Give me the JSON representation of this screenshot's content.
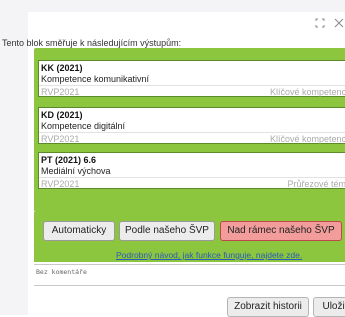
{
  "heading": "Tento blok směřuje k následujícím výstupům:",
  "toolbar": {
    "maximize_icon": "maximize-icon",
    "close_icon": "close-icon"
  },
  "outputs": [
    {
      "code": "KK (2021)",
      "name": "Kompetence komunikativní",
      "source": "RVP2021",
      "category": "Klíčové kompetence"
    },
    {
      "code": "KD (2021)",
      "name": "Kompetence digitální",
      "source": "RVP2021",
      "category": "Klíčové kompetence"
    },
    {
      "code": "PT (2021) 6.6",
      "name": "Mediální výchova",
      "source": "RVP2021",
      "category": "Průřezové téma"
    }
  ],
  "modes": {
    "automatic": "Automaticky",
    "by_svp": "Podle našeho ŠVP",
    "beyond_svp": "Nad rámec našeho ŠVP"
  },
  "help_link": "Podrobný návod, jak funkce funguje, najdete zde.",
  "comment_placeholder": "Bez komentáře",
  "footer": {
    "history": "Zobrazit historii",
    "save": "Uložit"
  },
  "colors": {
    "panel_green": "#8cc63f",
    "active_button": "#f29c9c"
  }
}
